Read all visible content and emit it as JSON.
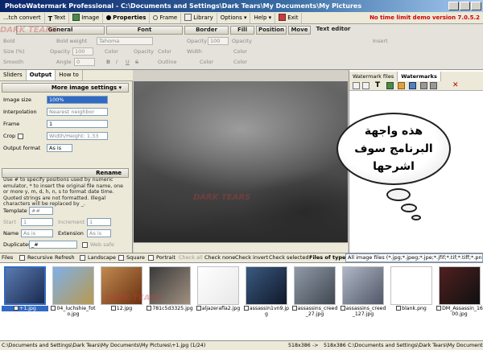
{
  "window": {
    "title": "PhotoWatermark Professional - C:\\Documents and Settings\\Dark Tears\\My Documents\\My Pictures"
  },
  "menubar": {
    "items": [
      "...tch convert",
      "Text",
      "Image",
      "Properties",
      "Frame",
      "Library",
      "Options",
      "Help",
      "Exit"
    ],
    "demo_notice": "No time limit demo version 7.0.5.2"
  },
  "properties": {
    "groups": [
      "General",
      "Font",
      "Border",
      "Fill",
      "Position",
      "Move",
      "Text editor"
    ],
    "row1": [
      "Bold",
      "Bold weight",
      "Tahoma",
      "Opacity",
      "100",
      "Opacity",
      "100",
      "Insert"
    ],
    "row2": [
      "Size (%)",
      "Opacity",
      "100",
      "Color",
      "Color",
      "Opacity",
      "Width",
      "Color"
    ],
    "row3": [
      "Smooth",
      "Angle",
      "0",
      "B",
      "I",
      "U",
      "S",
      "Outline",
      "Color",
      "Color"
    ]
  },
  "left_tabs": [
    "Sliders",
    "Output",
    "How to"
  ],
  "output": {
    "more_settings": "More image settings",
    "image_size_label": "Image size",
    "image_size_value": "100%",
    "interpolation_label": "Interpolation",
    "interpolation_value": "Nearest neighbor",
    "frame_label": "Frame",
    "frame_value": "1",
    "crop_label": "Crop",
    "crop_value": "Width/Height: 1.33",
    "format_label": "Output format",
    "format_value": "As is",
    "rename_header": "Rename",
    "help_text": "Use # to specify positions used by numeric emulator, * to insert the original file name, one or more y, m, d, h, n, s to format date time. Quoted strings are not formatted. Illegal characters will be replaced by _.",
    "template_label": "Template",
    "template_value": "##",
    "start_label": "Start",
    "start_value": "1",
    "increment_label": "Increment",
    "increment_value": "1",
    "name_label": "Name",
    "name_value": "As is",
    "extension_label": "Extension",
    "extension_value": "As is",
    "duplicates_label": "Duplicates",
    "duplicates_value": "_#",
    "websafe_label": "Web safe"
  },
  "right_tabs": [
    "Watermark files",
    "Watermarks"
  ],
  "bubble": {
    "lines": [
      "هذه واجهة",
      "البرنامج سوف",
      "اشرحها"
    ]
  },
  "filebar": {
    "files_label": "Files",
    "recursive": "Recursive",
    "refresh": "Refresh",
    "landscape": "Landscape",
    "square": "Square",
    "portrait": "Portrait",
    "check_all": "Check all",
    "check_none": "Check none",
    "check_invert": "Check invert",
    "check_selected": "Check selected",
    "files_of_type": "Files of type",
    "type_filter": "All image files (*.jpg;*.jpeg;*.jpe;*.jfif;*.tif;*.tiff;*.pn"
  },
  "thumbnails": [
    {
      "name": "+1.jpg",
      "selected": true,
      "c1": "#5a7bb0",
      "c2": "#1a2a50"
    },
    {
      "name": "04_luchshie_foto.jpg",
      "selected": false,
      "c1": "#7fb0e8",
      "c2": "#b89a50"
    },
    {
      "name": "12.jpg",
      "selected": false,
      "c1": "#c08a50",
      "c2": "#6a3010"
    },
    {
      "name": "781c5d3325.jpg",
      "selected": false,
      "c1": "#3a3a3a",
      "c2": "#a09080"
    },
    {
      "name": "aljazerafla2.jpg",
      "selected": false,
      "c1": "#ffffff",
      "c2": "#e8e8e8"
    },
    {
      "name": "assassin1vn9.jpg",
      "selected": false,
      "c1": "#3a5a80",
      "c2": "#10182a"
    },
    {
      "name": "assassins_creed_27.jpg",
      "selected": false,
      "c1": "#909aa8",
      "c2": "#404850"
    },
    {
      "name": "assassins_creed_127.jpg",
      "selected": false,
      "c1": "#b0b8c8",
      "c2": "#505868"
    },
    {
      "name": "blank.png",
      "selected": false,
      "c1": "#ffffff",
      "c2": "#ffffff"
    },
    {
      "name": "DM_Assassin_1600.jpg",
      "selected": false,
      "c1": "#502020",
      "c2": "#101010"
    }
  ],
  "status": {
    "path": "C:\\Documents and Settings\\Dark Tears\\My Documents\\My Pictures\\+1.jpg (1/24)",
    "size_from": "518x386",
    "arrow": "->",
    "size_to": "518x386",
    "right_path": "C:\\Documents and Settings\\Dark Tears\\My Documents\\"
  },
  "watermark_text": "DARK TEARS"
}
